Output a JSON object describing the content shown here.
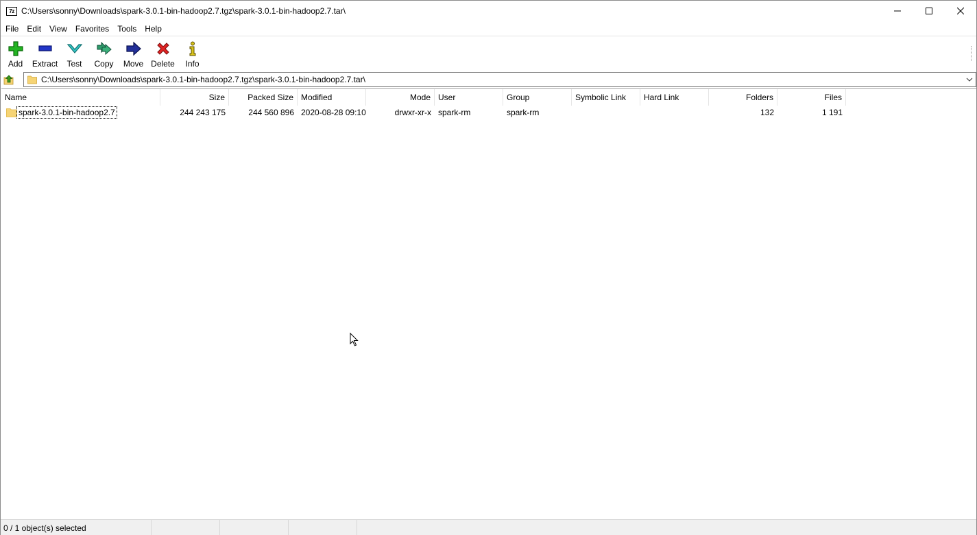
{
  "window": {
    "app_icon_text": "7z",
    "title": "C:\\Users\\sonny\\Downloads\\spark-3.0.1-bin-hadoop2.7.tgz\\spark-3.0.1-bin-hadoop2.7.tar\\"
  },
  "menu": {
    "items": [
      {
        "label": "File"
      },
      {
        "label": "Edit"
      },
      {
        "label": "View"
      },
      {
        "label": "Favorites"
      },
      {
        "label": "Tools"
      },
      {
        "label": "Help"
      }
    ]
  },
  "toolbar": {
    "buttons": [
      {
        "label": "Add",
        "icon": "plus-icon",
        "color": "#1aa31a"
      },
      {
        "label": "Extract",
        "icon": "minus-icon",
        "color": "#1f2fb0"
      },
      {
        "label": "Test",
        "icon": "check-down-icon",
        "color": "#1fa6a6"
      },
      {
        "label": "Copy",
        "icon": "double-arrow-icon",
        "color": "#2e8b57"
      },
      {
        "label": "Move",
        "icon": "arrow-right-icon",
        "color": "#1f2f8f"
      },
      {
        "label": "Delete",
        "icon": "x-icon",
        "color": "#d01c1c"
      },
      {
        "label": "Info",
        "icon": "info-icon",
        "color": "#a38a00"
      }
    ]
  },
  "address": {
    "path": "C:\\Users\\sonny\\Downloads\\spark-3.0.1-bin-hadoop2.7.tgz\\spark-3.0.1-bin-hadoop2.7.tar\\"
  },
  "columns": {
    "name": "Name",
    "size": "Size",
    "packed": "Packed Size",
    "modified": "Modified",
    "mode": "Mode",
    "user": "User",
    "group": "Group",
    "symlink": "Symbolic Link",
    "hardlink": "Hard Link",
    "folders": "Folders",
    "files": "Files"
  },
  "rows": [
    {
      "name": "spark-3.0.1-bin-hadoop2.7",
      "size": "244 243 175",
      "packed": "244 560 896",
      "modified": "2020-08-28 09:10",
      "mode": "drwxr-xr-x",
      "user": "spark-rm",
      "group": "spark-rm",
      "symlink": "",
      "hardlink": "",
      "folders": "132",
      "files": "1 191"
    }
  ],
  "status": {
    "selection": "0 / 1 object(s) selected",
    "cell2": "",
    "cell3": "",
    "cell4": ""
  },
  "colors": {
    "folder": "#f6d475",
    "folder_dark": "#e2b53e",
    "up_arrow": "#3a9a1a"
  }
}
